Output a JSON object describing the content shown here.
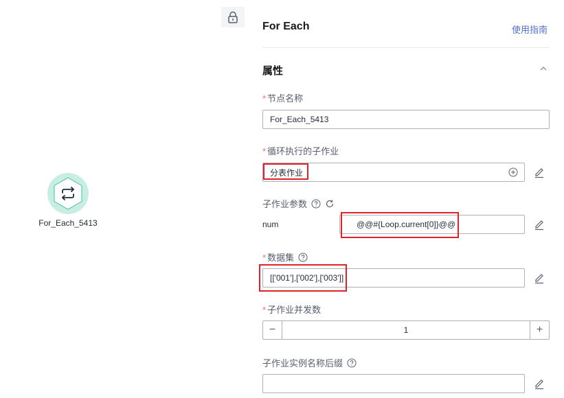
{
  "node": {
    "label": "For_Each_5413",
    "icon": "loop-icon",
    "color": "#3ec3a0"
  },
  "panel": {
    "title": "For Each",
    "guide_link": "使用指南",
    "section_title": "属性",
    "fields": {
      "node_name": {
        "label": "节点名称",
        "value": "For_Each_5413",
        "required": true
      },
      "sub_job": {
        "label": "循环执行的子作业",
        "value": "分表作业",
        "required": true
      },
      "sub_job_params": {
        "label": "子作业参数",
        "param_name": "num",
        "param_value": "@@#{Loop.current[0]}@@"
      },
      "dataset": {
        "label": "数据集",
        "value": "[['001'],['002'],['003']]",
        "required": true
      },
      "concurrency": {
        "label": "子作业并发数",
        "value": "1",
        "required": true
      },
      "instance_suffix": {
        "label": "子作业实例名称后缀",
        "value": ""
      }
    },
    "required_mark": "*",
    "stepper": {
      "minus": "−",
      "plus": "+"
    }
  },
  "colors": {
    "accent": "#526ecc",
    "highlight": "#e0212a",
    "required": "#f66f6a"
  }
}
